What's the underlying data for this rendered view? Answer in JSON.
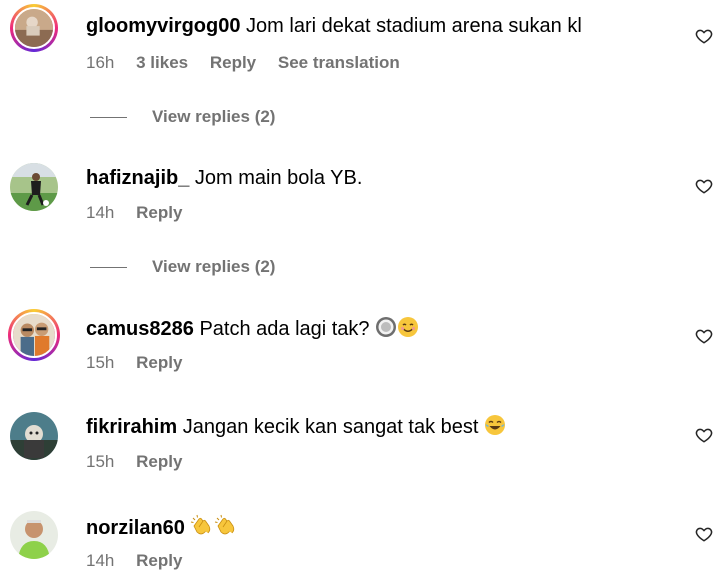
{
  "comments": [
    {
      "username": "gloomyvirgog00",
      "text": "Jom lari dekat stadium arena sukan kl",
      "time": "16h",
      "likes": "3 likes",
      "reply": "Reply",
      "translate": "See translation",
      "view_replies": "View replies (2)"
    },
    {
      "username": "hafiznajib_",
      "text": "Jom main bola YB.",
      "time": "14h",
      "reply": "Reply",
      "view_replies": "View replies (2)"
    },
    {
      "username": "camus8286",
      "text": "Patch ada lagi tak?",
      "time": "15h",
      "reply": "Reply"
    },
    {
      "username": "fikrirahim",
      "text": "Jangan kecik kan sangat tak best",
      "time": "15h",
      "reply": "Reply"
    },
    {
      "username": "norzilan60",
      "text": "",
      "time": "14h",
      "reply": "Reply"
    }
  ],
  "icons": {
    "like": "heart-outline-icon",
    "emoji_round_pushpin": "white-circle-icon",
    "emoji_smile": "smiling-face-icon",
    "emoji_laugh": "face-with-tears-of-joy-icon",
    "emoji_clap": "clapping-hands-icon"
  },
  "colors": {
    "meta_text": "#737373",
    "story_ring_start": "#f9ce34",
    "story_ring_mid": "#ee2a7b",
    "emoji_yellow": "#f7c63c"
  }
}
